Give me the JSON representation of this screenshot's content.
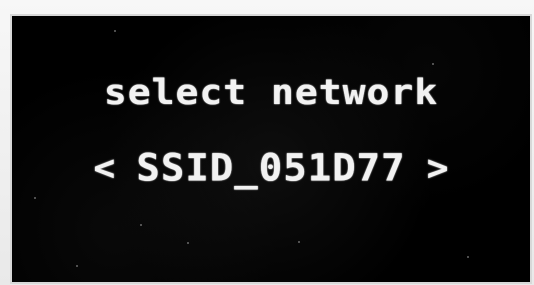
{
  "screen": {
    "title": "select network",
    "network_selector": {
      "left_arrow": "<",
      "ssid": "SSID_051D77",
      "right_arrow": ">"
    }
  },
  "colors": {
    "display_background": "#000000",
    "text": "#f2f2f2",
    "bezel": "#f3f3f3"
  }
}
